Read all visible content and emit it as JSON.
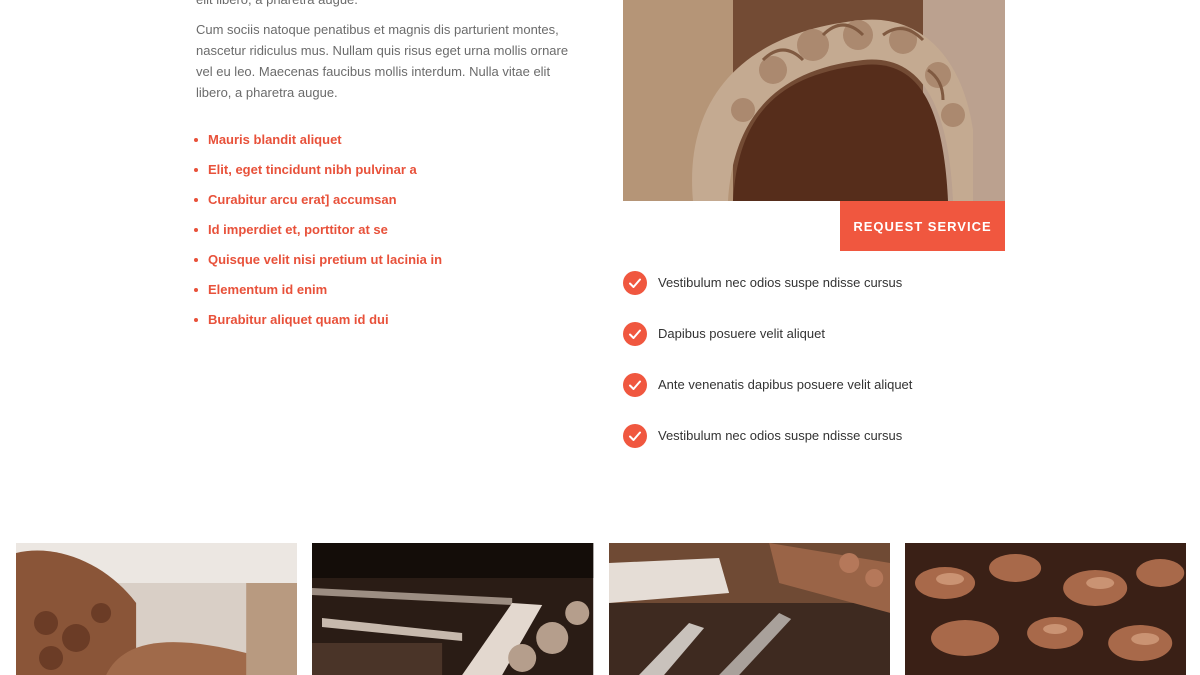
{
  "intro": {
    "cut_line": "elit libero, a pharetra augue.",
    "paragraph": "Cum sociis natoque penatibus et magnis dis parturient montes, nascetur ridiculus mus. Nullam quis risus eget urna mollis ornare vel eu leo. Maecenas faucibus mollis interdum. Nulla vitae elit libero, a pharetra augue."
  },
  "red_list": [
    "Mauris blandit aliquet",
    "Elit, eget tincidunt nibh pulvinar a",
    "Curabitur arcu erat] accumsan",
    "Id imperdiet et, porttitor at se",
    "Quisque velit nisi pretium ut lacinia in",
    "Elementum id enim",
    "Burabitur aliquet quam id dui"
  ],
  "hero": {
    "image": "carved-wood-arch-photo"
  },
  "request_button": {
    "label": "REQUEST SERVICE"
  },
  "checklist": [
    "Vestibulum nec odios suspe ndisse cursus",
    "Dapibus posuere velit aliquet",
    "Ante venenatis dapibus posuere velit aliquet",
    "Vestibulum nec odios suspe ndisse cursus"
  ],
  "gallery": [
    {
      "image": "carved-wood-bench-photo"
    },
    {
      "image": "woodworking-tools-photo"
    },
    {
      "image": "chisels-on-workbench-photo"
    },
    {
      "image": "ornamental-carving-photo"
    }
  ],
  "colors": {
    "accent": "#f0573f",
    "list_text": "#e8513a",
    "body_text": "#6b6b6b",
    "dark_text": "#333333"
  }
}
